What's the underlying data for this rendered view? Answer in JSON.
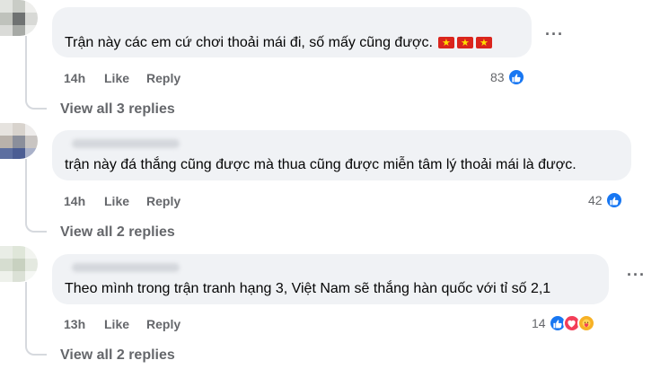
{
  "comments": [
    {
      "text": "Trận này các em cứ chơi thoải mái đi, số mấy cũng được.",
      "time": "14h",
      "like_label": "Like",
      "reply_label": "Reply",
      "reaction_count": "83",
      "reactions": [
        "like-icon"
      ],
      "view_replies": "View all 3 replies",
      "emoji": [
        "vietnam-flag",
        "vietnam-flag",
        "vietnam-flag"
      ]
    },
    {
      "text": "trận này đá thắng cũng được mà thua cũng được miễn tâm lý thoải mái là được.",
      "time": "14h",
      "like_label": "Like",
      "reply_label": "Reply",
      "reaction_count": "42",
      "reactions": [
        "like-icon"
      ],
      "view_replies": "View all 2 replies"
    },
    {
      "text": "Theo mình trong trận tranh hạng 3, Việt Nam sẽ thắng hàn quốc với tỉ số 2,1",
      "time": "13h",
      "like_label": "Like",
      "reply_label": "Reply",
      "reaction_count": "14",
      "reactions": [
        "like-icon",
        "love-icon",
        "care-icon"
      ],
      "view_replies": "View all 2 replies"
    }
  ],
  "more_options_label": "···",
  "colors": {
    "bubble": "#f0f2f5",
    "meta_text": "#65676b",
    "like_blue": "#1877f2",
    "love_red": "#f33e58",
    "care_yellow": "#f7b125",
    "flag_red": "#da251d",
    "flag_star": "#ffde00"
  }
}
